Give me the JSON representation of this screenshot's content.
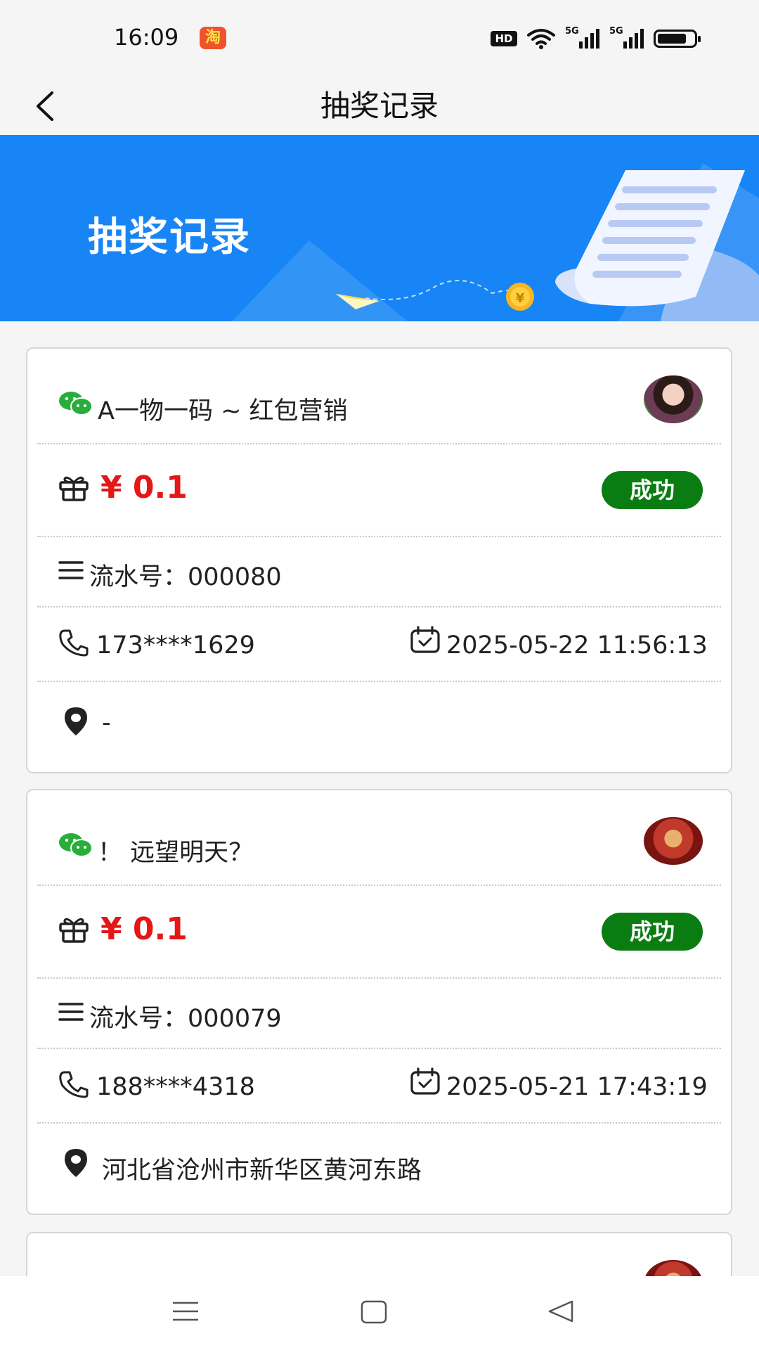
{
  "status_bar": {
    "time": "16:09",
    "app_badge": "淘",
    "hd_label": "HD",
    "signal_label_1": "5G",
    "signal_label_2": "5G",
    "battery_level": 0.8
  },
  "nav": {
    "title": "抽奖记录",
    "back_icon": "chevron-left-icon"
  },
  "banner": {
    "title": "抽奖记录",
    "coin_symbol": "¥"
  },
  "labels": {
    "serial_prefix": "流水号："
  },
  "records": [
    {
      "name": "A一物一码 ~ 红包营销",
      "amount": "¥ 0.1",
      "status": "成功",
      "serial": "000080",
      "phone": "173****1629",
      "datetime": "2025-05-22 11:56:13",
      "location": "-"
    },
    {
      "name": "！ 远望明天？",
      "amount": "¥ 0.1",
      "status": "成功",
      "serial": "000079",
      "phone": "188****4318",
      "datetime": "2025-05-21 17:43:19",
      "location": "河北省沧州市新华区黄河东路"
    }
  ],
  "colors": {
    "amount": "#e51616",
    "status_success": "#0a7d12",
    "banner": "#1785f5",
    "wechat": "#2aae3b"
  },
  "bottom_nav": {
    "menu_icon": "menu-icon",
    "home_icon": "home-square-icon",
    "back_icon": "back-triangle-icon"
  }
}
